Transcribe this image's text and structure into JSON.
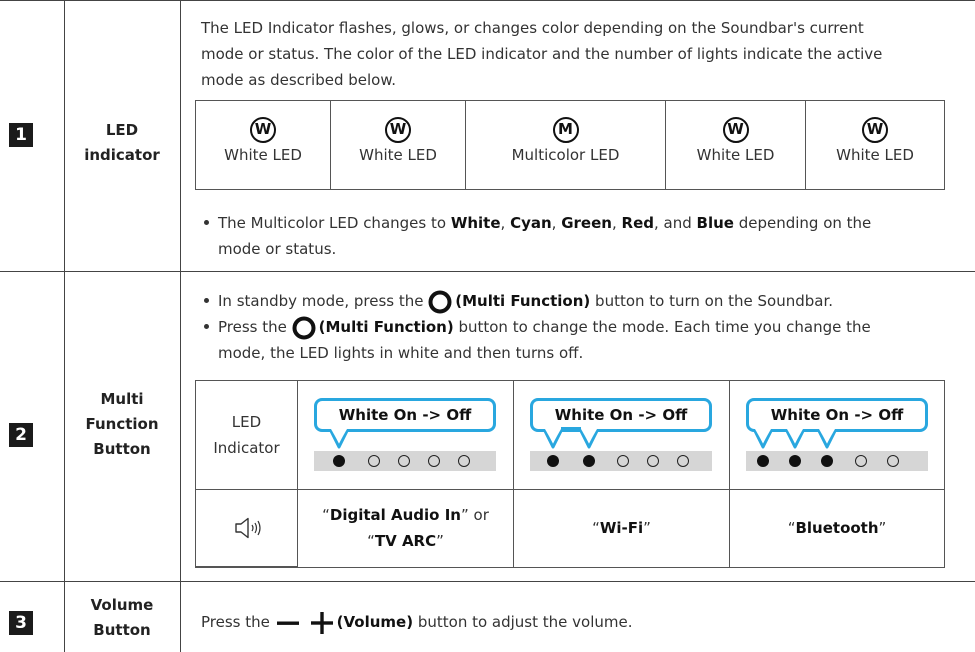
{
  "rows": [
    {
      "num": "1",
      "feature_lines": [
        "LED",
        "indicator"
      ]
    },
    {
      "num": "2",
      "feature_lines": [
        "Multi",
        "Function",
        "Button"
      ]
    },
    {
      "num": "3",
      "feature_lines": [
        "Volume",
        "Button"
      ]
    }
  ],
  "led": {
    "intro_lines": [
      "The LED Indicator flashes, glows, or changes color depending on the Soundbar's current",
      "mode or status. The color of the LED indicator and the number of lights indicate the active",
      "mode as described below."
    ],
    "items": [
      {
        "letter": "W",
        "label": "White LED"
      },
      {
        "letter": "W",
        "label": "White LED"
      },
      {
        "letter": "M",
        "label": "Multicolor LED"
      },
      {
        "letter": "W",
        "label": "White LED"
      },
      {
        "letter": "W",
        "label": "White LED"
      }
    ],
    "note": {
      "pre": "The Multicolor LED changes to ",
      "c1": "White",
      "s1": ", ",
      "c2": "Cyan",
      "s2": ", ",
      "c3": "Green",
      "s3": ", ",
      "c4": "Red",
      "s4": ", and ",
      "c5": "Blue",
      "post": " depending on the",
      "line2": "mode or status."
    }
  },
  "multi": {
    "bullet1": {
      "pre": "In standby mode, press the ",
      "bold": "(Multi Function)",
      "post": " button to turn on the Soundbar."
    },
    "bullet2": {
      "pre": "Press the ",
      "bold": "(Multi Function)",
      "post": " button to change the mode. Each time you change the",
      "line2": "mode, the LED lights in white and then turns off."
    },
    "table": {
      "row_label_lines": [
        "LED",
        "Indicator"
      ],
      "bubbles": [
        "White On -> Off",
        "White On -> Off",
        "White On -> Off"
      ],
      "leds": [
        [
          1,
          0,
          0,
          0,
          0
        ],
        [
          1,
          1,
          0,
          0,
          0
        ],
        [
          1,
          1,
          1,
          0,
          0
        ]
      ],
      "modes": [
        {
          "open": "“",
          "bold": "Digital Audio In",
          "close": "” or",
          "open2": "“",
          "bold2": "TV ARC",
          "close2": "”"
        },
        {
          "open": "“",
          "bold": "Wi-Fi",
          "close": "”"
        },
        {
          "open": "“",
          "bold": "Bluetooth",
          "close": "”"
        }
      ]
    }
  },
  "volume": {
    "pre": "Press the ",
    "bold": "(Volume)",
    "post": " button to adjust the volume."
  },
  "colors": {
    "border": "#444444",
    "bubble": "#29a7df",
    "dotbar": "#d6d6d6",
    "badge": "#1b1b1b"
  }
}
